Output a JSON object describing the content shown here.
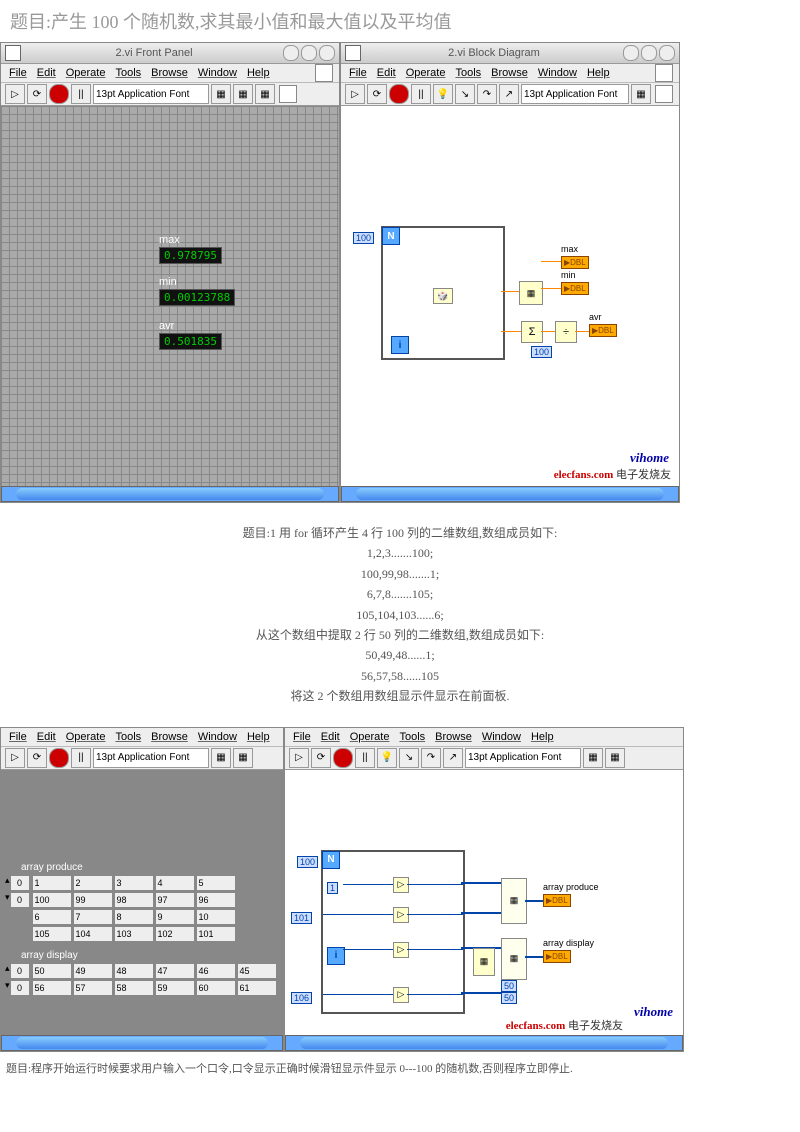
{
  "title1": "题目:产生 100 个随机数,求其最小值和最大值以及平均值",
  "win1": {
    "front_title": "2.vi Front Panel",
    "block_title": "2.vi Block Diagram",
    "menu": {
      "file": "File",
      "edit": "Edit",
      "operate": "Operate",
      "tools": "Tools",
      "browse": "Browse",
      "window": "Window",
      "help": "Help"
    },
    "font": "13pt Application Font",
    "max_label": "max",
    "max_val": "0.978795",
    "min_label": "min",
    "min_val": "0.00123788",
    "avr_label": "avr",
    "avr_val": "0.501835",
    "loop_n": "100",
    "n_sym": "N",
    "i_sym": "i",
    "div_const": "100",
    "dbl": "DBL",
    "sigma": "Σ",
    "divide": "÷",
    "watermark": "vihome",
    "elecfans": "elecfans.com",
    "elecfans_cn": "电子发烧友"
  },
  "text2": {
    "l1": "题目:1 用 for 循环产生 4 行 100 列的二维数组,数组成员如下:",
    "l2": "1,2,3.......100;",
    "l3": "100,99,98.......1;",
    "l4": "6,7,8.......105;",
    "l5": "105,104,103......6;",
    "l6": "从这个数组中提取 2 行 50 列的二维数组,数组成员如下:",
    "l7": "50,49,48......1;",
    "l8": "56,57,58......105",
    "l9": "将这 2 个数组用数组显示件显示在前面板."
  },
  "win2": {
    "menu": {
      "file": "File",
      "edit": "Edit",
      "operate": "Operate",
      "tools": "Tools",
      "browse": "Browse",
      "window": "Window",
      "help": "Help"
    },
    "font": "13pt Application Font",
    "arr1_label": "array produce",
    "arr1_idx": [
      "0",
      "0"
    ],
    "arr1": [
      [
        "1",
        "2",
        "3",
        "4",
        "5"
      ],
      [
        "100",
        "99",
        "98",
        "97",
        "96"
      ],
      [
        "6",
        "7",
        "8",
        "9",
        "10"
      ],
      [
        "105",
        "104",
        "103",
        "102",
        "101"
      ]
    ],
    "arr2_label": "array display",
    "arr2_idx": [
      "0",
      "0"
    ],
    "arr2": [
      [
        "50",
        "49",
        "48",
        "47",
        "46",
        "45"
      ],
      [
        "56",
        "57",
        "58",
        "59",
        "60",
        "61"
      ]
    ],
    "loop_n": "100",
    "n_sym": "N",
    "i_sym": "i",
    "c101": "101",
    "c106": "106",
    "c1": "1",
    "c50": "50",
    "ind1": "array produce",
    "ind2": "array display",
    "dbl": "DBL",
    "watermark": "vihome",
    "elecfans": "elecfans.com",
    "elecfans_cn": "电子发烧友"
  },
  "title3": "题目:程序开始运行时候要求用户输入一个口令,口令显示正确时候滑钮显示件显示 0---100 的随机数,否则程序立即停止."
}
